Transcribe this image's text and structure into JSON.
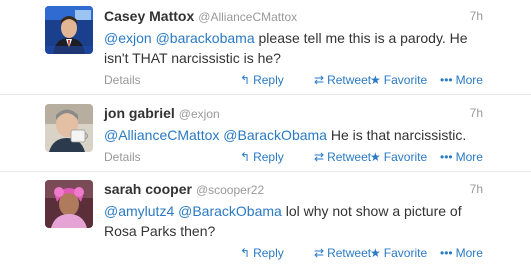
{
  "tweets": [
    {
      "fullname": "Casey Mattox",
      "username": "@AllianceCMattox",
      "time": "7h",
      "mentions": [
        "@exjon",
        "@barackobama"
      ],
      "text": " please tell me this is a parody. He\nisn't THAT narcissistic is he?",
      "avatar_icon": "news-anchor-avatar"
    },
    {
      "fullname": "jon gabriel",
      "username": "@exjon",
      "time": "7h",
      "mentions": [
        "@AllianceCMattox",
        "@BarackObama"
      ],
      "text": " He is that narcissistic.",
      "avatar_icon": "man-drinking-avatar"
    },
    {
      "fullname": "sarah cooper",
      "username": "@scooper22",
      "time": "7h",
      "mentions": [
        "@amylutz4",
        "@BarackObama"
      ],
      "text": " lol why not show a picture of\nRosa Parks then?",
      "avatar_icon": "woman-pink-avatar"
    }
  ],
  "actions": {
    "details": "Details",
    "reply": "Reply",
    "retweet": "Retweet",
    "favorite": "Favorite",
    "more": "More"
  },
  "icons": {
    "reply": "reply-arrow-icon",
    "retweet": "retweet-arrows-icon",
    "favorite": "star-icon",
    "more": "dots-icon"
  },
  "colors": {
    "link": "#2a7ac4",
    "muted": "#999999",
    "text": "#333333"
  }
}
